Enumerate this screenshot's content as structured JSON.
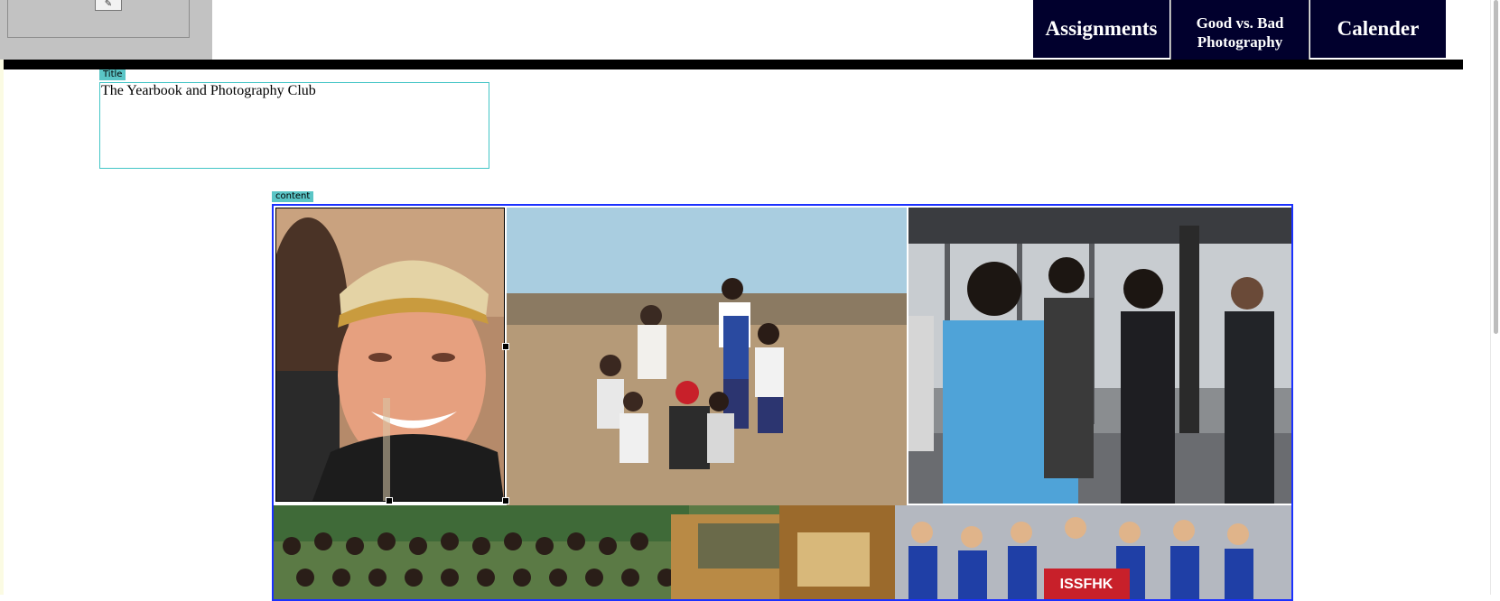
{
  "nav": {
    "assignments": "Assignments",
    "good_vs_bad": "Good vs. Bad Photography",
    "calender": "Calender"
  },
  "title_region": {
    "tag": "Title",
    "text": "The Yearbook and Photography Club"
  },
  "content_region": {
    "tag": "content"
  },
  "colors": {
    "nav_bg": "#01002d",
    "bar": "#000000",
    "region_outline": "#42c5c6",
    "content_outline": "#1b31ff"
  }
}
